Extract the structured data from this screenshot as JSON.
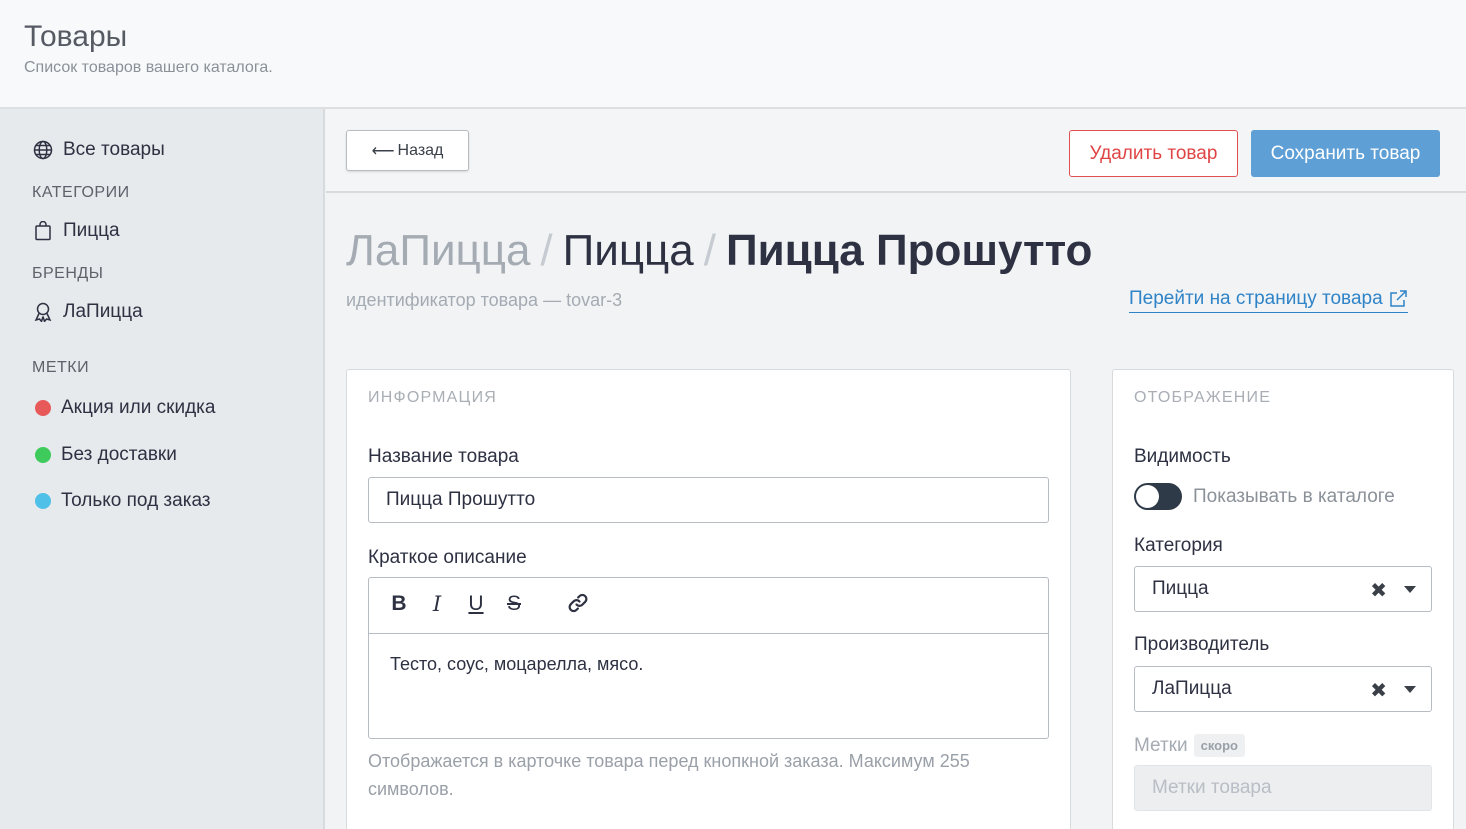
{
  "header": {
    "title": "Товары",
    "subtitle": "Список товаров вашего каталога."
  },
  "sidebar": {
    "all_products": "Все товары",
    "categories_heading": "КАТЕГОРИИ",
    "categories": [
      "Пицца"
    ],
    "brands_heading": "БРЕНДЫ",
    "brands": [
      "ЛаПицца"
    ],
    "tags_heading": "МЕТКИ",
    "tags": [
      {
        "label": "Акция или скидка",
        "color": "#e85a5a"
      },
      {
        "label": "Без доставки",
        "color": "#3ecb5c"
      },
      {
        "label": "Только под заказ",
        "color": "#4fc0e8"
      }
    ]
  },
  "toolbar": {
    "back_label": "Назад",
    "delete_label": "Удалить товар",
    "save_label": "Сохранить товар"
  },
  "breadcrumb": {
    "brand": "ЛаПицца",
    "category": "Пицца",
    "product": "Пицца Прошутто",
    "separator": "/"
  },
  "product": {
    "id_text": "идентификатор товара — tovar-3",
    "link_text": "Перейти на страницу товара"
  },
  "info_card": {
    "heading": "ИНФОРМАЦИЯ",
    "name_label": "Название товара",
    "name_value": "Пицца Прошутто",
    "description_label": "Краткое описание",
    "description_value": "Тесто, соус, моцарелла, мясо.",
    "description_hint": "Отображается в карточке товара перед кнопкной заказа. Максимум 255 символов.",
    "tools": [
      "B",
      "I",
      "U",
      "S"
    ]
  },
  "display_card": {
    "heading": "ОТОБРАЖЕНИЕ",
    "visibility_label": "Видимость",
    "visibility_toggle_label": "Показывать в каталоге",
    "category_label": "Категория",
    "category_value": "Пицца",
    "manufacturer_label": "Производитель",
    "manufacturer_value": "ЛаПицца",
    "tags_label": "Метки",
    "tags_badge": "скоро",
    "tags_placeholder": "Метки товара"
  },
  "colors": {
    "accent": "#5e9fd6",
    "danger": "#e04545",
    "link": "#2f83c7"
  }
}
